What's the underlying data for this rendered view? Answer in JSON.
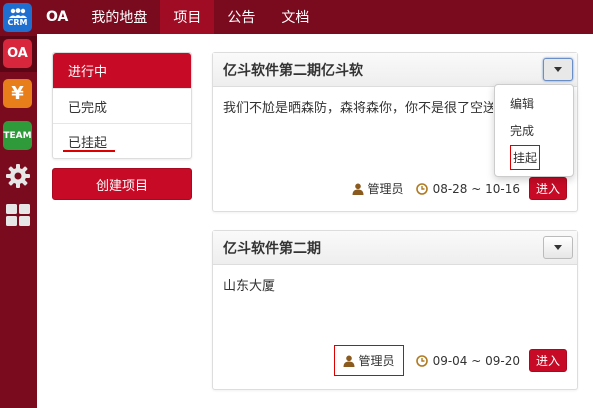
{
  "rail": {
    "apps": [
      {
        "label": "CRM",
        "color": "#1f6fd1"
      },
      {
        "label": "OA",
        "color": "#d8263d"
      },
      {
        "label": "¥",
        "color": "#e87e1a"
      },
      {
        "label": "TEAM",
        "color": "#2e9a3a"
      },
      {
        "icon": "gear-icon"
      },
      {
        "icon": "grid-icon"
      }
    ]
  },
  "topbar": {
    "brand": "OA",
    "items": [
      "我的地盘",
      "项目",
      "公告",
      "文档"
    ],
    "active": "项目"
  },
  "submenu": {
    "items": [
      "进行中",
      "已完成",
      "已挂起"
    ],
    "active": "进行中"
  },
  "create_button": "创建项目",
  "projects": [
    {
      "title": "亿斗软件第二期亿斗软",
      "description": "我们不尬是晒森防，森将森你，你不是很了空送",
      "owner": "管理员",
      "date_range": "08-28 ~ 10-16",
      "enter_label": "进入"
    },
    {
      "title": "亿斗软件第二期",
      "description": "山东大厦",
      "owner": "管理员",
      "date_range": "09-04 ~ 09-20",
      "enter_label": "进入"
    }
  ],
  "dropdown_menu": {
    "items": [
      "编辑",
      "完成",
      "挂起"
    ]
  },
  "colors": {
    "brand_dark": "#7a0a1e",
    "accent_red": "#c70b26",
    "owner_icon": "#8a5a1e",
    "clock_icon": "#b07a20"
  }
}
